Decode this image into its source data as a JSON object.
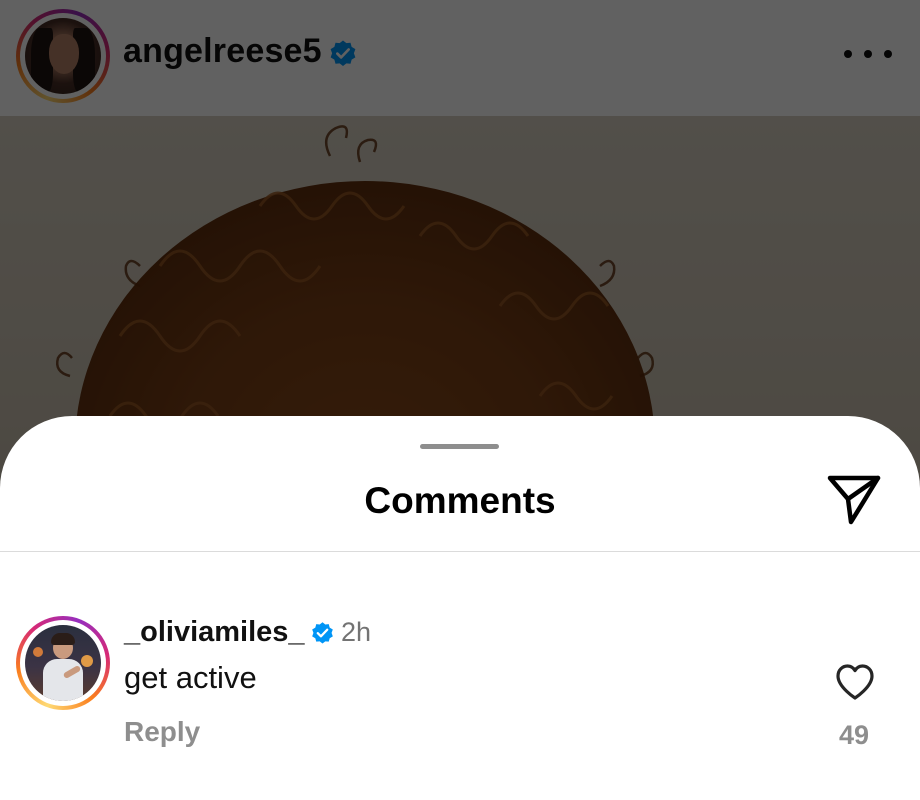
{
  "post": {
    "username": "angelreese5",
    "verified": true,
    "more_icon": "ellipsis-horizontal-icon"
  },
  "comments_sheet": {
    "title": "Comments",
    "share_icon": "paper-plane-icon"
  },
  "comments": [
    {
      "username": "_oliviamiles_",
      "verified": true,
      "time": "2h",
      "text": "get active",
      "reply_label": "Reply",
      "like_count": "49",
      "like_icon": "heart-outline-icon"
    }
  ],
  "colors": {
    "verified_blue": "#0095f6",
    "secondary_text": "#8e8e8e",
    "overlay": "rgba(0,0,0,0.62)"
  }
}
